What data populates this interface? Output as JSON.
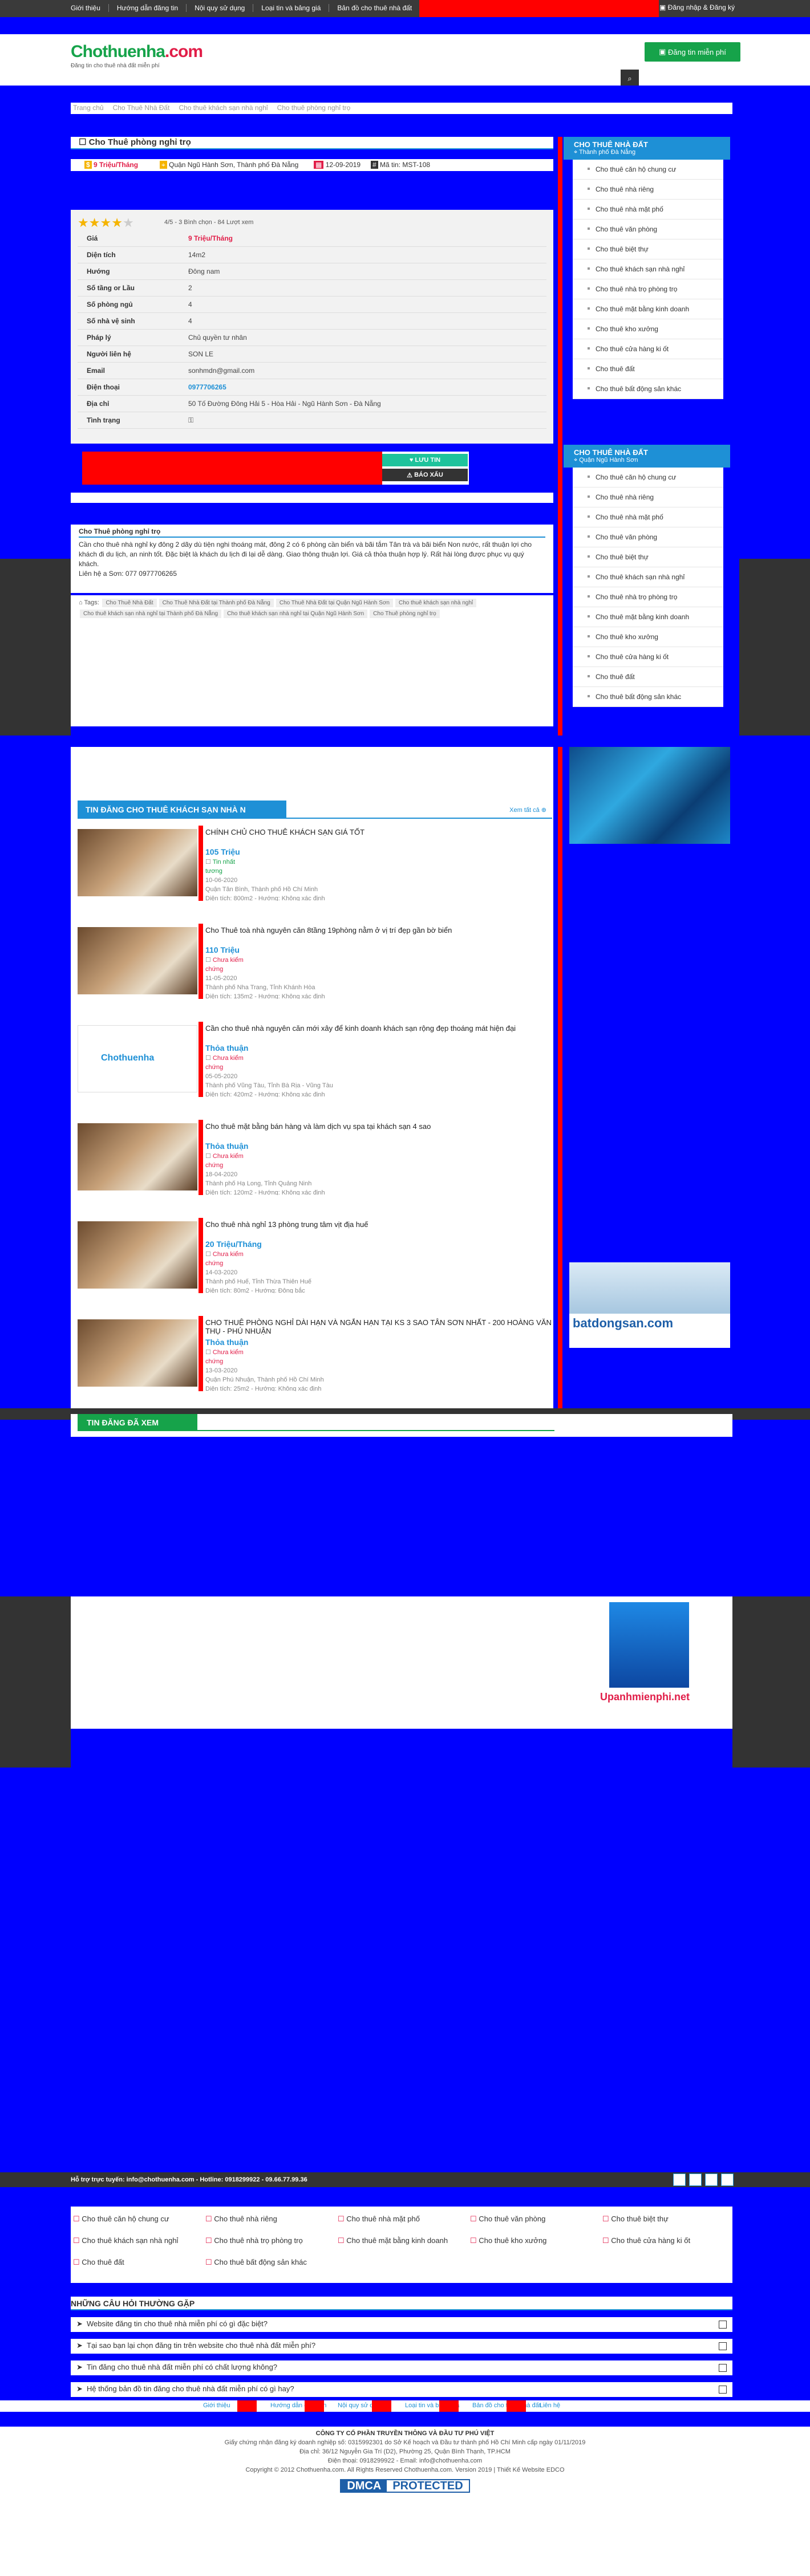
{
  "topbar": {
    "menu": [
      "Giới thiệu",
      "Hướng dẫn đăng tin",
      "Nội quy sử dụng",
      "Loại tin và bảng giá",
      "Bản đồ cho thuê nhà đất"
    ],
    "login": "Đăng nhập & Đăng ký"
  },
  "header": {
    "logo_main": "Chothuenha",
    "logo_tld": ".com",
    "slogan": "Đăng tin cho thuê nhà đất miễn phí",
    "post_button": "Đăng tin miễn phí",
    "search_icon": "search-icon"
  },
  "breadcrumb": [
    "Trang chủ",
    "Cho Thuê Nhà Đất",
    "Cho thuê khách sạn nhà nghỉ",
    "Cho thuê phòng nghỉ trọ"
  ],
  "post": {
    "title": "Cho Thuê phòng nghỉ trọ",
    "price": "9 Triệu/Tháng",
    "location": "Quận Ngũ Hành Sơn, Thành phố Đà Nẵng",
    "date": "12-09-2019",
    "code": "Mã tin: MST-108",
    "rating_text": "4/5 - 3 Bình chọn - 84 Lượt xem",
    "rating": 4,
    "details": [
      {
        "k": "Giá",
        "v": "9 Triệu/Tháng"
      },
      {
        "k": "Diện tích",
        "v": "14m2"
      },
      {
        "k": "Hướng",
        "v": "Đông nam"
      },
      {
        "k": "Số tầng or Lầu",
        "v": "2"
      },
      {
        "k": "Số phòng ngủ",
        "v": "4"
      },
      {
        "k": "Số nhà vệ sinh",
        "v": "4"
      },
      {
        "k": "Pháp lý",
        "v": "Chủ quyền tư nhân"
      },
      {
        "k": "Người liên hệ",
        "v": "SON LE"
      },
      {
        "k": "Email",
        "v": "sonhmdn@gmail.com"
      },
      {
        "k": "Điện thoại",
        "v": "0977706265"
      },
      {
        "k": "Địa chỉ",
        "v": "50 Tố Đường Đông Hải 5 - Hòa Hải - Ngũ Hành Sơn - Đà Nẵng"
      },
      {
        "k": "Tình trạng",
        "v": ""
      }
    ],
    "save_button": "LƯU TIN",
    "report_button": "BÁO XẤU",
    "desc_title": "Cho Thuê phòng nghỉ trọ",
    "description": "Cần cho thuê nhà nghỉ ky đông 2 dãy dù tiện nghi thoáng mát, đông 2 có 6 phòng cần biển và bãi tắm Tân trà và bãi biển Non nước, rất thuận lợi cho khách đi du lịch, an ninh tốt. Đặc biệt là khách du lịch đi lại dễ dàng. Giao thông thuận lợi. Giá cả thỏa thuận hợp lý. Rất hài lòng được phục vụ quý khách.",
    "contact_line": "Liên hệ a Sơn: 077 0977706265",
    "tags_label": "Tags:",
    "tags": [
      "Cho Thuê Nhà Đất",
      "Cho Thuê Nhà Đất tại Thành phố Đà Nẵng",
      "Cho Thuê Nhà Đất tại Quận Ngũ Hành Sơn",
      "Cho thuê khách sạn nhà nghỉ",
      "Cho thuê khách sạn nhà nghỉ tại Thành phố Đà Nẵng",
      "Cho thuê khách sạn nhà nghỉ tại Quận Ngũ Hành Sơn",
      "Cho Thuê phòng nghỉ trọ"
    ]
  },
  "sidebar1": {
    "title": "CHO THUÊ NHÀ ĐẤT",
    "subtitle": "Thành phố Đà Nẵng",
    "items": [
      "Cho thuê căn hộ chung cư",
      "Cho thuê nhà riêng",
      "Cho thuê nhà mặt phố",
      "Cho thuê văn phòng",
      "Cho thuê biệt thự",
      "Cho thuê khách sạn nhà nghỉ",
      "Cho thuê nhà trọ phòng trọ",
      "Cho thuê mặt bằng kinh doanh",
      "Cho thuê kho xưởng",
      "Cho thuê cửa hàng ki ốt",
      "Cho thuê đất",
      "Cho thuê bất động sản khác"
    ]
  },
  "sidebar2": {
    "title": "CHO THUÊ NHÀ ĐẤT",
    "subtitle": "Quận Ngũ Hành Sơn",
    "items": [
      "Cho thuê căn hộ chung cư",
      "Cho thuê nhà riêng",
      "Cho thuê nhà mặt phố",
      "Cho thuê văn phòng",
      "Cho thuê biệt thự",
      "Cho thuê khách sạn nhà nghỉ",
      "Cho thuê nhà trọ phòng trọ",
      "Cho thuê mặt bằng kinh doanh",
      "Cho thuê kho xưởng",
      "Cho thuê cửa hàng ki ốt",
      "Cho thuê đất",
      "Cho thuê bất động sản khác"
    ]
  },
  "related": {
    "title": "TIN ĐĂNG CHO THUÊ KHÁCH SẠN NHÀ N",
    "more": "Xem tất cả",
    "items": [
      {
        "title": "CHÍNH CHỦ CHO THUÊ KHÁCH SẠN GIÁ TỐT",
        "price": "105 Triệu",
        "status": "Tin nhất",
        "who": "tương",
        "date": "10-06-2020",
        "place": "Quận Tân Bình, Thành phố Hồ Chí Minh",
        "area": "Diện tích: 800m2 - Hướng: Không xác định"
      },
      {
        "title": "Cho Thuê toà nhà nguyên căn 8tầng 19phòng nằm ở vị trí đẹp gần bờ biển",
        "price": "110 Triệu",
        "status": "Chưa kiểm",
        "who": "chứng",
        "date": "11-05-2020",
        "place": "Thành phố Nha Trang, Tỉnh Khánh Hòa",
        "area": "Diện tích: 135m2 - Hướng: Không xác định"
      },
      {
        "title": "Cần cho thuê nhà nguyên căn mới xây để kinh doanh khách sạn rộng đẹp thoáng mát hiện đại",
        "price": "Thỏa thuận",
        "status": "Chưa kiểm",
        "who": "chứng",
        "date": "05-05-2020",
        "place": "Thành phố Vũng Tàu, Tỉnh Bà Rịa - Vũng Tàu",
        "area": "Diện tích: 420m2 - Hướng: Không xác định"
      },
      {
        "title": "Cho thuê mặt bằng bán hàng và làm dịch vụ spa tại khách sạn 4 sao",
        "price": "Thỏa thuận",
        "status": "Chưa kiểm",
        "who": "chứng",
        "date": "18-04-2020",
        "place": "Thành phố Hạ Long, Tỉnh Quảng Ninh",
        "area": "Diện tích: 120m2 - Hướng: Không xác định"
      },
      {
        "title": "Cho thuê nhà nghỉ 13 phòng trung tâm vịt địa huế",
        "price": "20 Triệu/Tháng",
        "status": "Chưa kiểm",
        "who": "chứng",
        "date": "14-03-2020",
        "place": "Thành phố Huế, Tỉnh Thừa Thiên Huế",
        "area": "Diện tích: 80m2 - Hướng: Đông bắc"
      },
      {
        "title": "CHO THUÊ PHÒNG NGHỈ DÀI HẠN VÀ NGẮN HẠN TẠI KS 3 SAO TÂN SƠN NHẤT - 200 HOÀNG VĂN THỤ - PHÚ NHUẬN",
        "price": "Thỏa thuận",
        "status": "Chưa kiểm",
        "who": "chứng",
        "date": "13-03-2020",
        "place": "Quận Phú Nhuận, Thành phố Hồ Chí Minh",
        "area": "Diện tích: 25m2 - Hướng: Không xác định"
      }
    ]
  },
  "viewed": {
    "title": "TIN ĐĂNG ĐÃ XEM"
  },
  "ads": {
    "batdongsan": "batdongsan.com",
    "upanh": "Upanhmienphi.net"
  },
  "footer": {
    "hotline_bar": "Hỗ trợ trực tuyến: info@chothuenha.com - Hotline: 0918299922 - 09.66.77.99.36",
    "categories": [
      "Cho thuê căn hộ chung cư",
      "Cho thuê nhà riêng",
      "Cho thuê nhà mặt phố",
      "Cho thuê văn phòng",
      "Cho thuê biệt thự",
      "Cho thuê khách sạn nhà nghỉ",
      "Cho thuê nhà trọ phòng trọ",
      "Cho thuê mặt bằng kinh doanh",
      "Cho thuê kho xưởng",
      "Cho thuê cửa hàng ki ốt",
      "Cho thuê đất",
      "Cho thuê bất động sản khác"
    ],
    "faq_title": "NHỮNG CÂU HỎI THƯỜNG GẶP",
    "faq": [
      "Website đăng tin cho thuê nhà miễn phí có gì đặc biệt?",
      "Tại sao bạn lại chọn đăng tin trên website cho thuê nhà đất miễn phí?",
      "Tin đăng cho thuê nhà đất miễn phí có chất lượng không?",
      "Hệ thống bản đồ tin đăng cho thuê nhà đất miễn phí có gì hay?"
    ],
    "links": [
      "Giới thiệu",
      "Hướng dẫn đăng tin",
      "Nội quy sử dụng",
      "Loại tin và bảng giá",
      "Bản đồ cho thuê nhà đất",
      "Liên hệ"
    ],
    "company": "CÔNG TY CỔ PHẦN TRUYỀN THÔNG VÀ ĐẦU TƯ PHÚ VIỆT",
    "license": "Giấy chứng nhận đăng ký doanh nghiệp số: 0315992301 do Sở Kế hoạch và Đầu tư thành phố Hồ Chí Minh cấp ngày 01/11/2019",
    "address": "Địa chỉ: 36/12 Nguyễn Gia Trí (D2), Phường 25, Quận Bình Thạnh, TP.HCM",
    "phone": "Điện thoại: 0918299922 - Email: info@chothuenha.com",
    "copyright": "Copyright © 2012 Chothuenha.com. All Rights Reserved Chothuenha.com. Version 2019 | Thiết Kế Website EDCO",
    "dmca": "DMCA",
    "protected": "PROTECTED"
  }
}
